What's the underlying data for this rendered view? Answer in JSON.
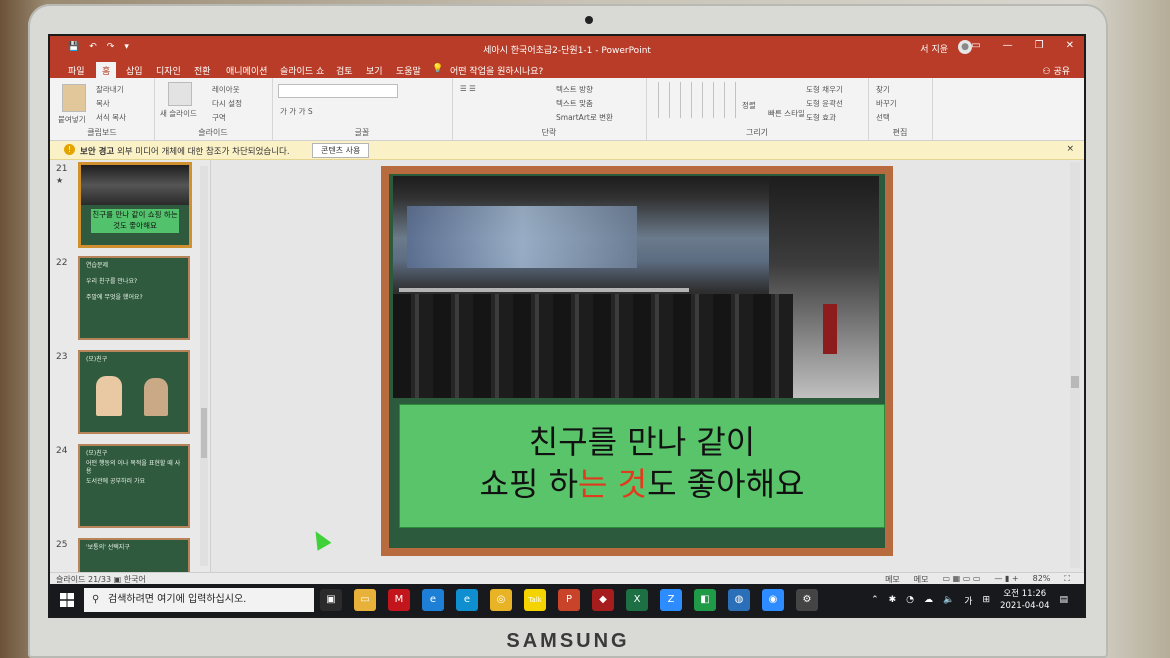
{
  "titlebar": {
    "document_title": "세아시 한국어초급2-단원1-1 - PowerPoint",
    "user_name": "서 지윤",
    "quick_access": [
      "💾",
      "↶",
      "↷",
      "▾"
    ],
    "window_controls": [
      "▭",
      "—",
      "❐",
      "✕"
    ]
  },
  "ribbon_tabs": {
    "items": [
      "파일",
      "홈",
      "삽입",
      "디자인",
      "전환",
      "애니메이션",
      "슬라이드 쇼",
      "검토",
      "보기",
      "도움말"
    ],
    "active": "홈",
    "tell_me": "어떤 작업을 원하시나요?",
    "share": "공유"
  },
  "ribbon": {
    "clipboard": {
      "label": "클립보드",
      "paste": "붙여넣기",
      "cut": "잘라내기",
      "copy": "복사",
      "format_painter": "서식 복사"
    },
    "slides": {
      "label": "슬라이드",
      "new_slide": "새 슬라이드",
      "layout": "레이아웃",
      "reset": "다시 설정",
      "section": "구역"
    },
    "font": {
      "label": "글꼴"
    },
    "paragraph": {
      "label": "단락",
      "text_direction": "텍스트 방향",
      "align_text": "텍스트 맞춤",
      "smartart": "SmartArt로 변환"
    },
    "drawing": {
      "label": "그리기",
      "arrange": "정렬",
      "quick_styles": "빠른 스타일",
      "fill": "도형 채우기",
      "outline": "도형 윤곽선",
      "effects": "도형 효과"
    },
    "editing": {
      "label": "편집",
      "find": "찾기",
      "replace": "바꾸기",
      "select": "선택"
    }
  },
  "security_bar": {
    "title": "보안 경고",
    "message": "외부 미디어 개체에 대한 참조가 차단되었습니다.",
    "button": "콘텐츠 사용",
    "close": "×"
  },
  "thumbnails": [
    {
      "number": "21",
      "star": "★",
      "caption": "친구를 만나 같이 쇼핑 하는 것도 좋아해요"
    },
    {
      "number": "22",
      "lines": [
        "연습문제",
        "우리 친구를 만나요?",
        "주말에 무엇을 했어요?"
      ]
    },
    {
      "number": "23",
      "lines": [
        "(모)친구"
      ]
    },
    {
      "number": "24",
      "lines": [
        "(모)친구",
        "어떤 행동의 이나 목적을 표현할 때 사용",
        "도서관에 공부하러 가요"
      ]
    },
    {
      "number": "25",
      "lines": [
        "'보통의' 선택지구"
      ]
    }
  ],
  "slide": {
    "caption_line1": "친구를 만나 같이",
    "caption_line2_before": "쇼핑 하",
    "caption_line2_highlight": "는 것",
    "caption_line2_after": "도 좋아해요"
  },
  "statusbar": {
    "slide_info": "슬라이드 21/33",
    "language": "한국어",
    "notes": "메모",
    "comments": "메모",
    "zoom": "82%"
  },
  "taskbar": {
    "search_placeholder": "검색하려면 여기에 입력하십시오.",
    "time": "오전 11:26",
    "date": "2021-04-04",
    "ime": "가",
    "apps": [
      {
        "name": "task-view",
        "color": "#2b2b2b",
        "glyph": "▣"
      },
      {
        "name": "file-explorer",
        "color": "#e8b13a",
        "glyph": "▭"
      },
      {
        "name": "mcafee",
        "color": "#c3161c",
        "glyph": "M"
      },
      {
        "name": "ie",
        "color": "#1e7fd6",
        "glyph": "e"
      },
      {
        "name": "edge",
        "color": "#0f8fd0",
        "glyph": "e"
      },
      {
        "name": "chrome",
        "color": "#e8b324",
        "glyph": "◎"
      },
      {
        "name": "kakaotalk",
        "color": "#f3d400",
        "glyph": "Talk"
      },
      {
        "name": "powerpoint",
        "color": "#c9432a",
        "glyph": "P"
      },
      {
        "name": "red-app",
        "color": "#a51d1d",
        "glyph": "◆"
      },
      {
        "name": "excel",
        "color": "#1d7044",
        "glyph": "X"
      },
      {
        "name": "zoom-app",
        "color": "#2d8cff",
        "glyph": "Z"
      },
      {
        "name": "green-app",
        "color": "#1f9a46",
        "glyph": "◧"
      },
      {
        "name": "globe-app",
        "color": "#2a6fb8",
        "glyph": "◍"
      },
      {
        "name": "zoom-video",
        "color": "#2d8cff",
        "glyph": "◉"
      },
      {
        "name": "tool-app",
        "color": "#444444",
        "glyph": "⚙"
      }
    ]
  },
  "device": {
    "brand": "SAMSUNG"
  },
  "colors": {
    "titlebar": "#b83c27",
    "caption_bg": "#59c46a",
    "highlight": "#e23a1c"
  }
}
